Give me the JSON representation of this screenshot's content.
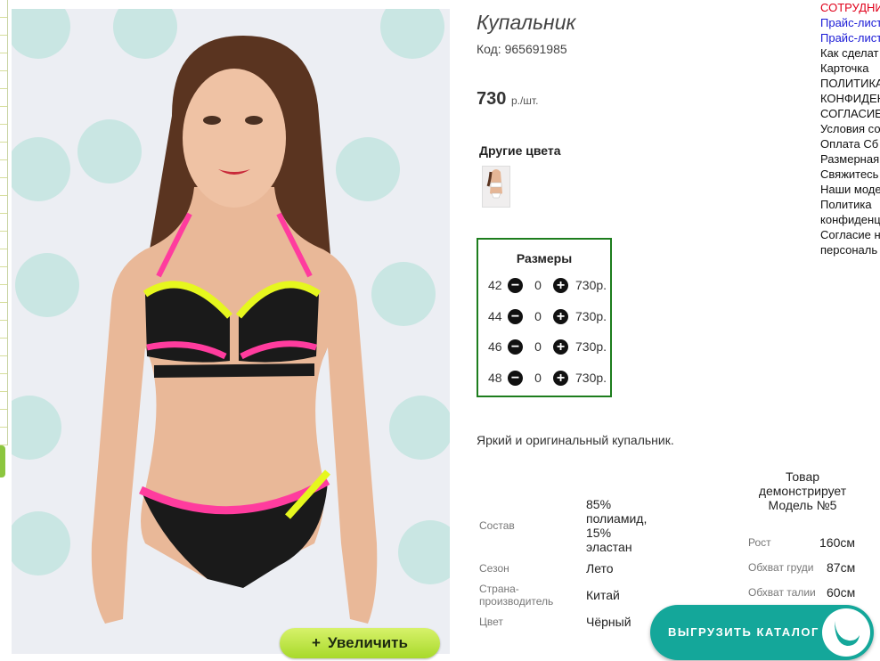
{
  "product": {
    "title": "Купальник",
    "code": "Код: 965691985",
    "price": "730",
    "price_unit": "р./шт.",
    "other_colors_heading": "Другие цвета",
    "zoom_button": "Увеличить",
    "zoom_icon": "+"
  },
  "sizes": {
    "heading": "Размеры",
    "rows": [
      {
        "size": "42",
        "qty": "0",
        "price": "730р."
      },
      {
        "size": "44",
        "qty": "0",
        "price": "730р."
      },
      {
        "size": "46",
        "qty": "0",
        "price": "730р."
      },
      {
        "size": "48",
        "qty": "0",
        "price": "730р."
      }
    ]
  },
  "description": "Яркий и оригинальный купальник.",
  "specs": {
    "composition_label": "Состав",
    "composition_value": "85% полиамид, 15% эластан",
    "season_label": "Сезон",
    "season_value": "Лето",
    "country_label": "Страна-производитель",
    "country_value": "Китай",
    "color_label": "Цвет",
    "color_value": "Чёрный"
  },
  "model": {
    "heading": "Товар демонстрирует Модель №5",
    "height_label": "Рост",
    "height_value": "160см",
    "chest_label": "Обхват груди",
    "chest_value": "87см",
    "waist_label": "Обхват талии",
    "waist_value": "60см"
  },
  "sidebar": {
    "links": [
      {
        "text": "СОТРУДНИ",
        "color": "red"
      },
      {
        "text": "Прайс-лист",
        "color": "blue"
      },
      {
        "text": "Прайс-лист",
        "color": "blue"
      },
      {
        "text": "Как сделат",
        "color": "black"
      },
      {
        "text": "Карточка",
        "color": "black"
      },
      {
        "text": "ПОЛИТИКА",
        "color": "black"
      },
      {
        "text": "КОНФИДЕН",
        "color": "black"
      },
      {
        "text": "СОГЛАСИЕ",
        "color": "black"
      },
      {
        "text": "Условия со",
        "color": "black"
      },
      {
        "text": "Оплата Сб",
        "color": "black"
      },
      {
        "text": "Размерная",
        "color": "black"
      },
      {
        "text": "Свяжитесь",
        "color": "black"
      },
      {
        "text": "Наши моде",
        "color": "black"
      },
      {
        "text": "Политика",
        "color": "black"
      },
      {
        "text": "конфиденц",
        "color": "black"
      },
      {
        "text": "Согласие н",
        "color": "black"
      },
      {
        "text": "персональ",
        "color": "black"
      }
    ]
  },
  "catalog_button": "ВЫГРУЗИТЬ КАТАЛОГ",
  "colors": {
    "accent_green": "#1d7d1d",
    "catalog_teal": "#14a79a",
    "zoom_lime": "#c4e84a"
  }
}
